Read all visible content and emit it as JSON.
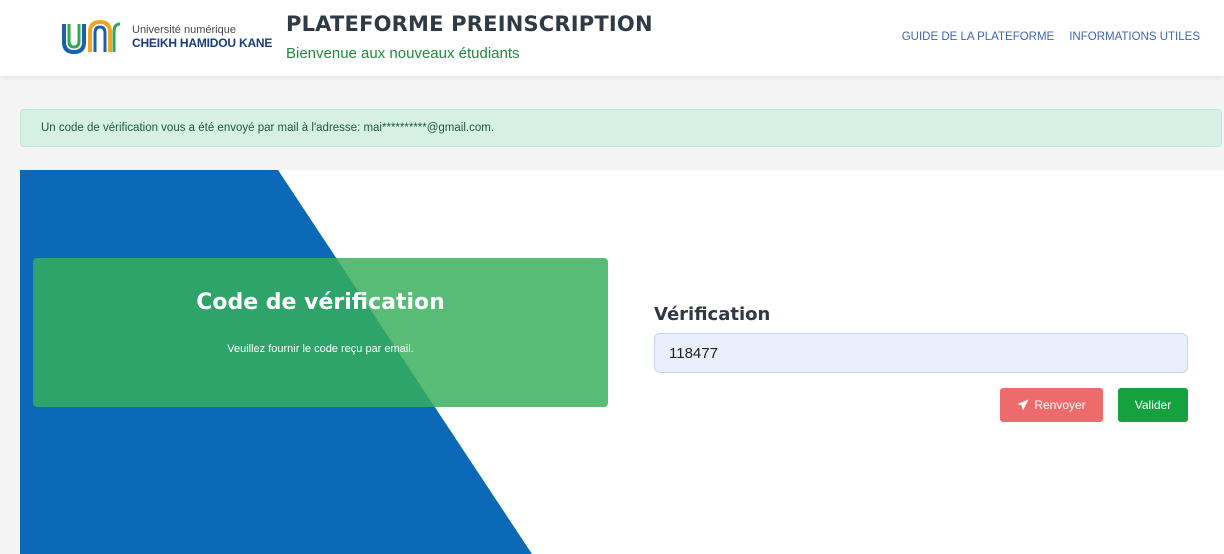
{
  "header": {
    "logo": {
      "line1": "Université numérique",
      "line2": "CHEIKH HAMIDOU KANE"
    },
    "title": "PLATEFORME PREINSCRIPTION",
    "subtitle": "Bienvenue aux nouveaux étudiants",
    "nav": [
      {
        "label": "GUIDE DE LA PLATEFORME"
      },
      {
        "label": "INFORMATIONS UTILES"
      }
    ]
  },
  "alert": {
    "message": "Un code de vérification vous a été envoyé par mail à l'adresse: mai**********@gmail.com."
  },
  "panel": {
    "title": "Code de vérification",
    "description": "Veuillez fournir le code reçu par email."
  },
  "form": {
    "label": "Vérification",
    "code_value": "118477",
    "resend_label": "Renvoyer",
    "resend_icon": "paper-plane-icon",
    "validate_label": "Valider"
  },
  "colors": {
    "blue_shape": "#0b69b7",
    "green_panel": "#36af5a",
    "alert_bg": "#d6f0e5",
    "resend_button": "#ee6b6b",
    "validate_button": "#16a13f",
    "subtitle": "#1e8a3e",
    "nav_link": "#3d66b3"
  }
}
